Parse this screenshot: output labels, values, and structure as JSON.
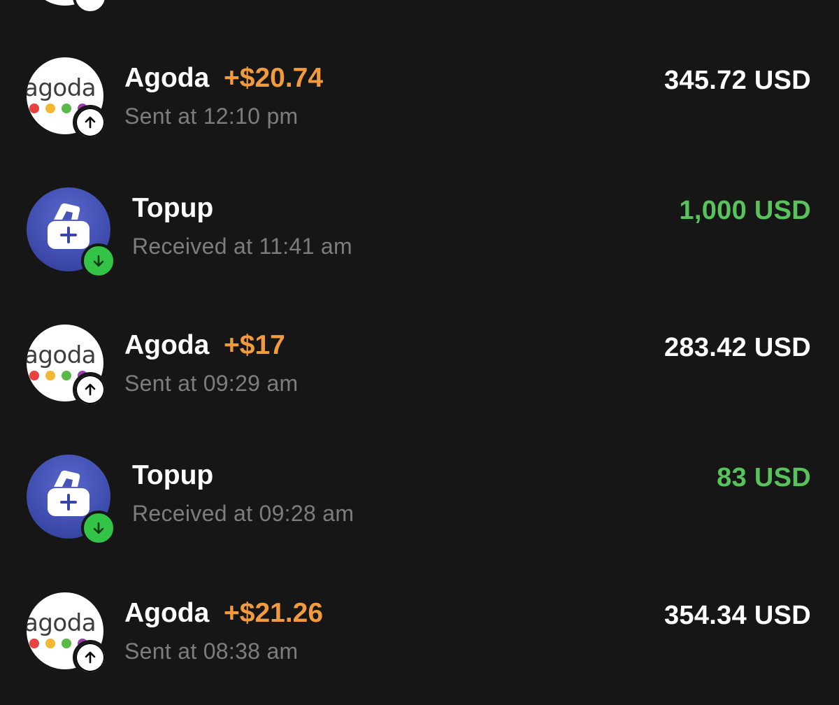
{
  "colors": {
    "background": "#161616",
    "primary_text": "#ffffff",
    "secondary_text": "#7d7d7d",
    "cashback": "#f19a3e",
    "credit_amount": "#58c25c",
    "received_badge": "#33c447",
    "topup_avatar": "#4654b8",
    "agoda_dots": [
      "#e8413f",
      "#f4b731",
      "#58b947",
      "#9b3fa7"
    ]
  },
  "transactions": [
    {
      "merchant": "Agoda",
      "logo_text": "agoda",
      "cashback": "+$20.74",
      "subtitle": "Sent at 12:10 pm",
      "amount": "345.72 USD",
      "direction_icon": "arrow-up-icon"
    },
    {
      "merchant": "Topup",
      "cashback": "",
      "subtitle": "Received at 11:41 am",
      "amount": "1,000 USD",
      "direction_icon": "arrow-down-icon"
    },
    {
      "merchant": "Agoda",
      "logo_text": "agoda",
      "cashback": "+$17",
      "subtitle": "Sent at 09:29 am",
      "amount": "283.42 USD",
      "direction_icon": "arrow-up-icon"
    },
    {
      "merchant": "Topup",
      "cashback": "",
      "subtitle": "Received at 09:28 am",
      "amount": "83 USD",
      "direction_icon": "arrow-down-icon"
    },
    {
      "merchant": "Agoda",
      "logo_text": "agoda",
      "cashback": "+$21.26",
      "subtitle": "Sent at 08:38 am",
      "amount": "354.34 USD",
      "direction_icon": "arrow-up-icon"
    }
  ]
}
